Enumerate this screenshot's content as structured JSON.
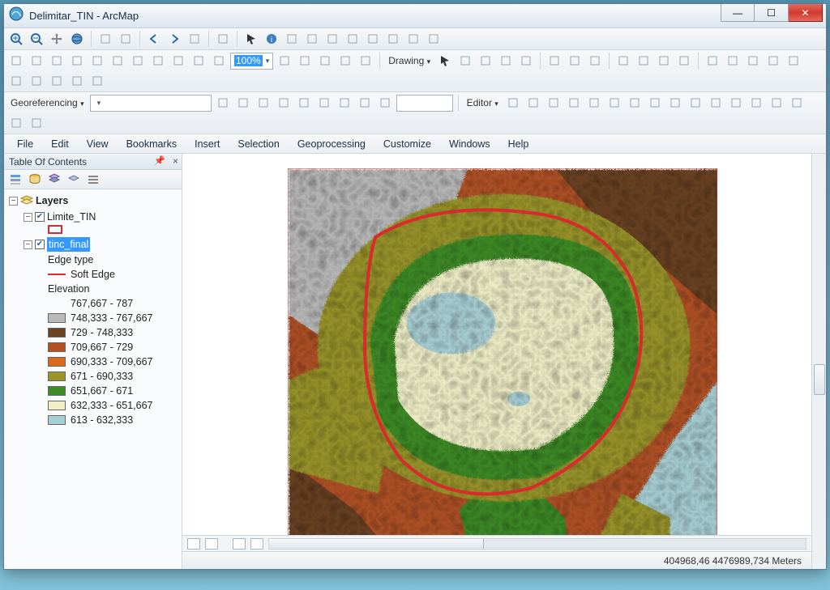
{
  "window": {
    "title": "Delimitar_TIN - ArcMap"
  },
  "menus": [
    "File",
    "Edit",
    "View",
    "Bookmarks",
    "Insert",
    "Selection",
    "Geoprocessing",
    "Customize",
    "Windows",
    "Help"
  ],
  "toolbar1_icons": [
    "zoom-in-icon",
    "zoom-out-icon",
    "pan-icon",
    "globe-icon",
    "fit-in-icon",
    "fit-out-icon",
    "back-icon",
    "forward-icon",
    "toggle-scale-icon",
    "dropdown-icon",
    "pointer-icon",
    "identify-icon",
    "hyperlink-icon",
    "html-popup-icon",
    "measure-icon",
    "find-icon",
    "xy-icon",
    "xy2-icon",
    "timeslider-icon",
    "window-icon"
  ],
  "toolbar2_icons": [
    "new-icon",
    "open-icon",
    "save-icon",
    "print-icon",
    "cut-icon",
    "copy-icon",
    "paste-icon",
    "undo-icon",
    "redo-icon",
    "scale-combo",
    "pct"
  ],
  "toolbar2_zoom": "100%",
  "drawing_label": "Drawing",
  "drawing_icons": [
    "pointer-icon",
    "rotate-icon",
    "rectangle-icon",
    "text-icon",
    "edit-vertices-icon"
  ],
  "toolbar2b_icons": [
    "new-doc-icon",
    "open-folder-icon",
    "save2-icon",
    "print2-icon"
  ],
  "toolbar2c_icons": [
    "t1",
    "t2",
    "t3",
    "t4",
    "t5",
    "t6",
    "t7",
    "t8",
    "t9",
    "t10"
  ],
  "georef_label": "Georeferencing",
  "georef_icons": [
    "g1",
    "g2",
    "g3",
    "g4",
    "g5",
    "g6",
    "g7",
    "g8",
    "g9"
  ],
  "editor_label": "Editor",
  "editor_icons": [
    "e1",
    "e2",
    "e3",
    "e4",
    "e5",
    "e6",
    "e7",
    "e8",
    "e9",
    "e10",
    "e11",
    "e12",
    "e13",
    "e14",
    "e15",
    "e16",
    "e17"
  ],
  "toc": {
    "title": "Table Of Contents",
    "root": "Layers",
    "layer1": "Limite_TIN",
    "layer2": "tinc_final",
    "edge_type": "Edge type",
    "soft_edge": "Soft Edge",
    "elevation": "Elevation"
  },
  "legend": [
    {
      "color": "NONE",
      "label": "767,667 - 787"
    },
    {
      "color": "#b9b9b9",
      "label": "748,333 - 767,667"
    },
    {
      "color": "#6b4323",
      "label": "729 - 748,333"
    },
    {
      "color": "#b25222",
      "label": "709,667 - 729"
    },
    {
      "color": "#d9691e",
      "label": "690,333 - 709,667"
    },
    {
      "color": "#99942c",
      "label": "671 - 690,333"
    },
    {
      "color": "#3e8b27",
      "label": "651,667 - 671"
    },
    {
      "color": "#f0efc8",
      "label": "632,333 - 651,667"
    },
    {
      "color": "#a8cfd4",
      "label": "613 - 632,333"
    }
  ],
  "status": "404968,46 4476989,734 Meters"
}
